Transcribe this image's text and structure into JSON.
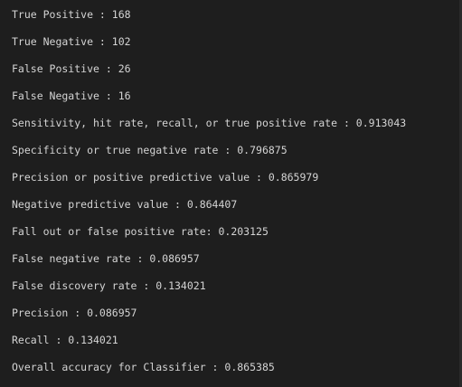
{
  "output": {
    "lines": [
      "True Positive : 168",
      "True Negative : 102",
      "False Positive : 26",
      "False Negative : 16",
      "Sensitivity, hit rate, recall, or true positive rate : 0.913043",
      "Specificity or true negative rate : 0.796875",
      "Precision or positive predictive value : 0.865979",
      "Negative predictive value : 0.864407",
      "Fall out or false positive rate: 0.203125",
      "False negative rate : 0.086957",
      "False discovery rate : 0.134021",
      "Precision : 0.086957",
      "Recall : 0.134021",
      "Overall accuracy for Classifier : 0.865385"
    ]
  }
}
